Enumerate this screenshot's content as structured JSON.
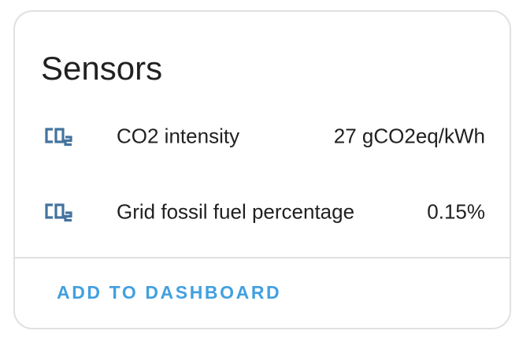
{
  "card": {
    "title": "Sensors",
    "entities": [
      {
        "icon": "co2-icon",
        "name": "CO2 intensity",
        "state": "27 gCO2eq/kWh"
      },
      {
        "icon": "co2-icon",
        "name": "Grid fossil fuel percentage",
        "state": "0.15%"
      }
    ],
    "action_label": "ADD TO DASHBOARD"
  },
  "colors": {
    "icon": "#44739e",
    "accent": "#42a0e0",
    "text": "#212121",
    "border": "#e1e1e1"
  }
}
